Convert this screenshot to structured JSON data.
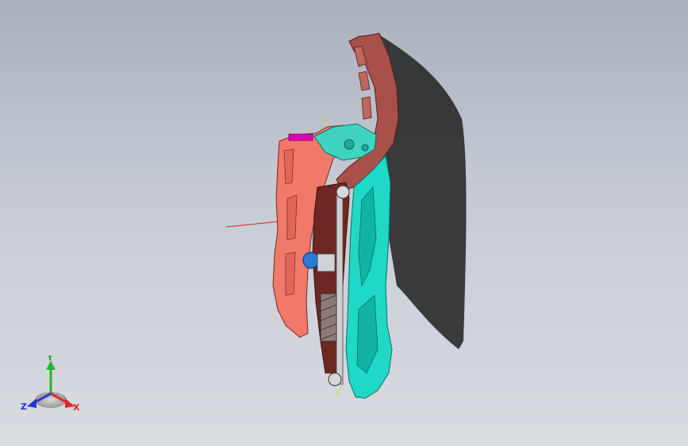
{
  "viewport": {
    "background_top": "#a9b1bd",
    "background_bottom": "#d9dce1"
  },
  "model": {
    "colors": {
      "housing": "#f0796a",
      "housing_dark": "#8a2f2a",
      "frame": "#a8504a",
      "lens": "#1fd8c6",
      "lens_shadow": "#12b3a5",
      "bracket": "#3fd3c0",
      "tag": "#e000b6",
      "motor": "#2d7ad6",
      "shadow": "#2c2c2e"
    }
  },
  "triad": {
    "x_label": "X",
    "y_label": "Y",
    "z_label": "Z",
    "x_color": "#e0282a",
    "y_color": "#27b52b",
    "z_color": "#2637d6"
  }
}
